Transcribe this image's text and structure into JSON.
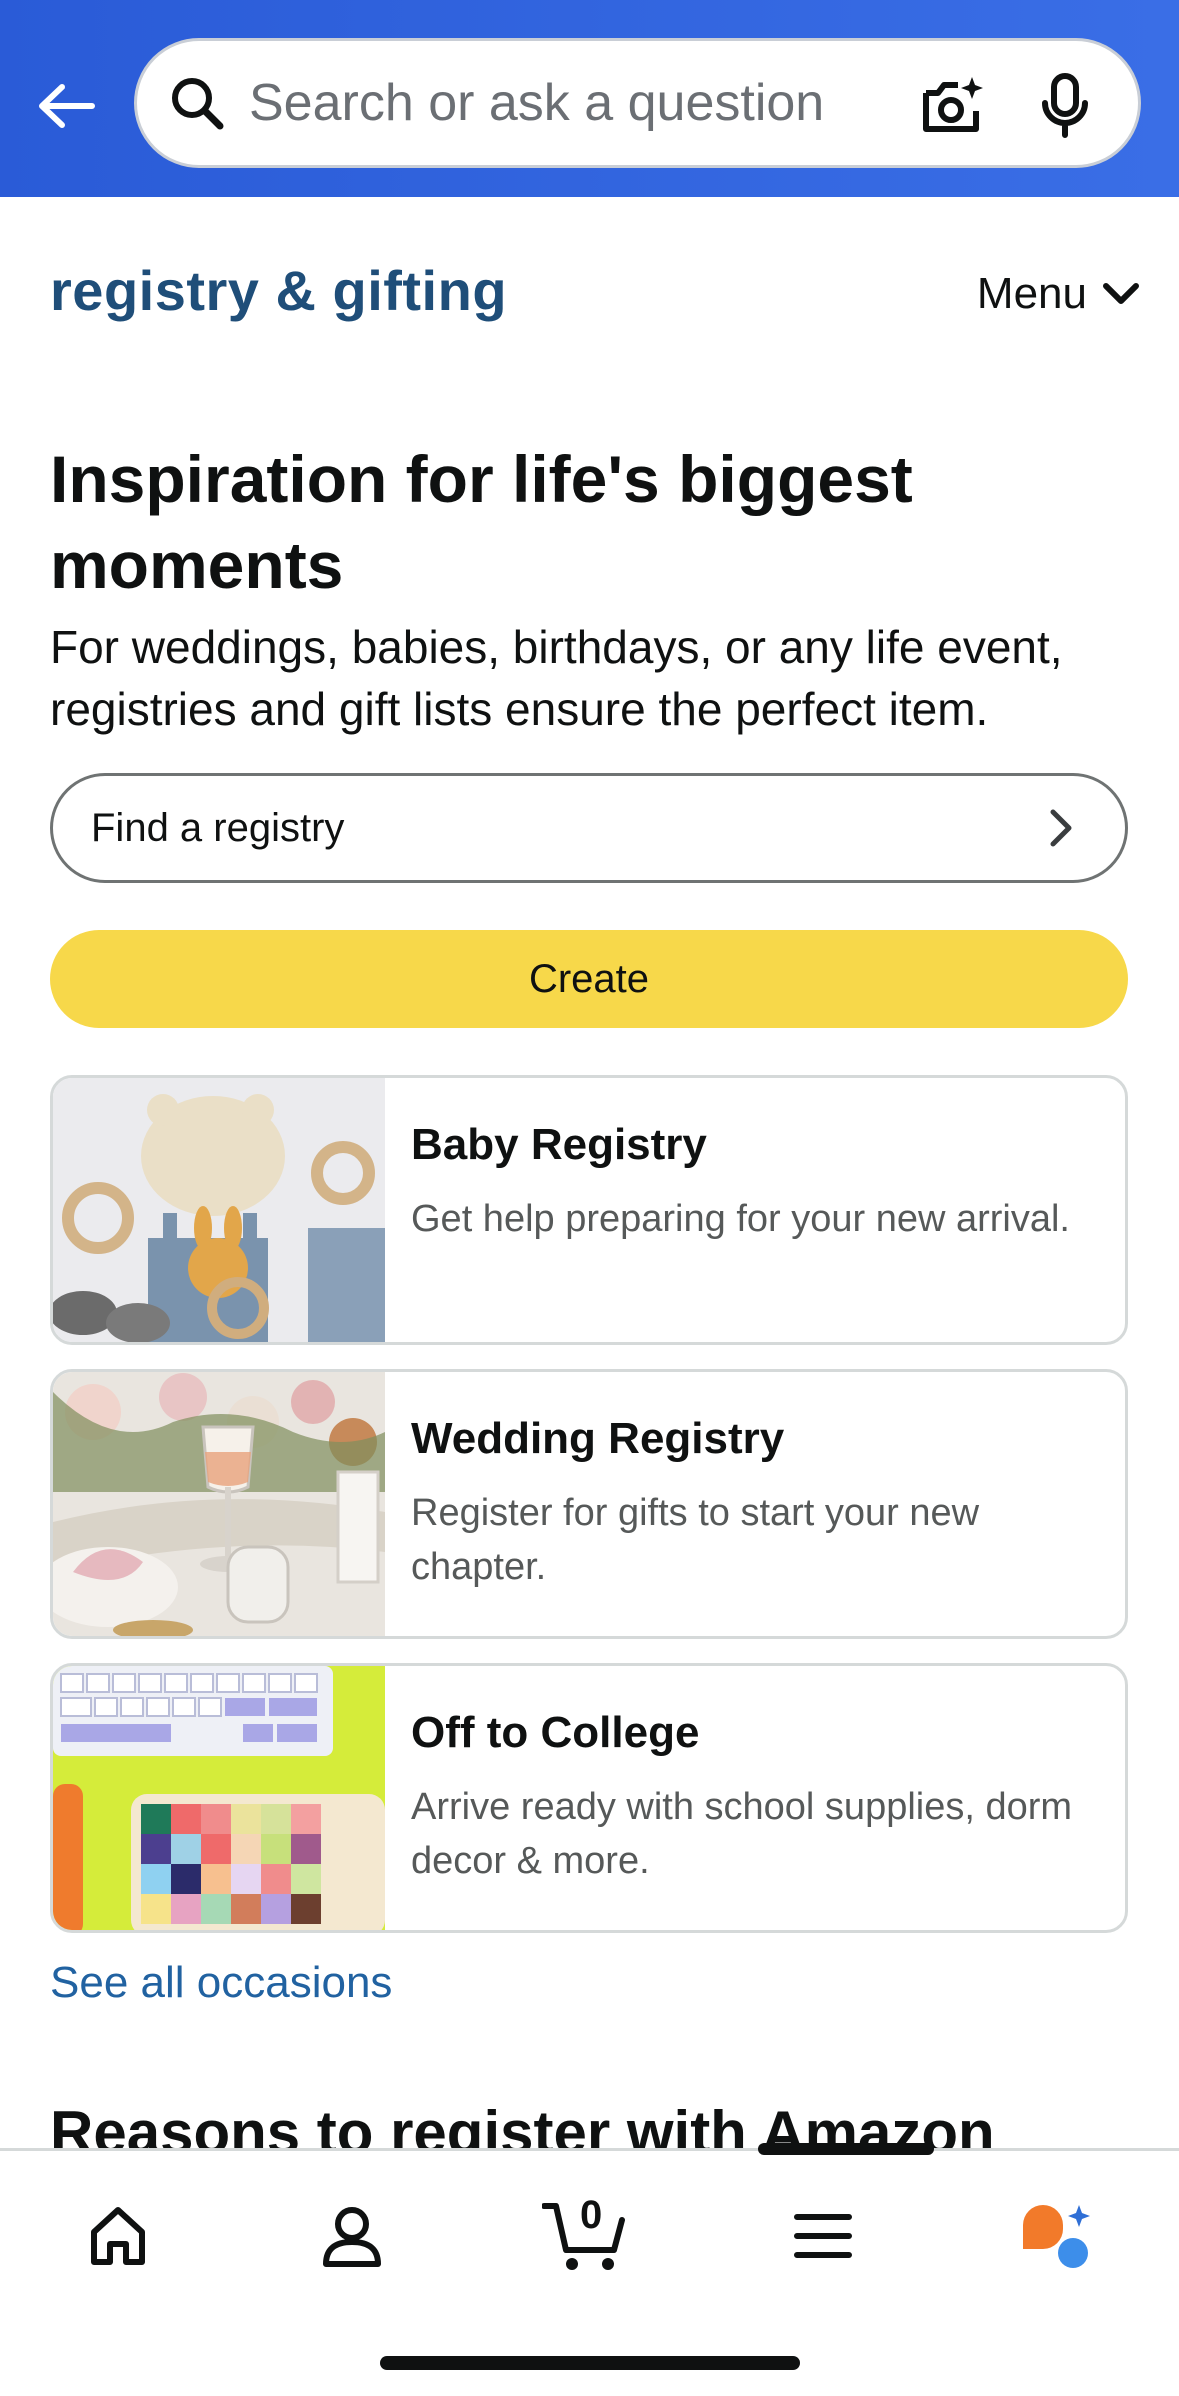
{
  "header": {
    "search_placeholder": "Search or ask a question"
  },
  "subnav": {
    "brand": "registry & gifting",
    "menu_label": "Menu"
  },
  "hero": {
    "title": "Inspiration for life's biggest moments",
    "subtitle": "For weddings, babies, birthdays, or any life event, registries and gift lists ensure the perfect item.",
    "find_registry_label": "Find a registry",
    "create_label": "Create"
  },
  "cards": [
    {
      "title": "Baby Registry",
      "description": "Get help preparing for your new arrival."
    },
    {
      "title": "Wedding Registry",
      "description": "Register for gifts to start your new chapter."
    },
    {
      "title": "Off to College",
      "description": "Arrive ready with school supplies, dorm decor & more."
    }
  ],
  "see_all_label": "See all occasions",
  "reasons_heading": "Reasons to register with Amazon",
  "bottom_nav": {
    "cart_count": "0",
    "items": [
      "home-icon",
      "account-icon",
      "cart-icon",
      "menu-icon",
      "rufus-assistant-icon"
    ]
  },
  "colors": {
    "header_bg": "#2a5bd7",
    "brand": "#1f4e79",
    "create_button": "#f7d84a",
    "link": "#2162a1"
  }
}
